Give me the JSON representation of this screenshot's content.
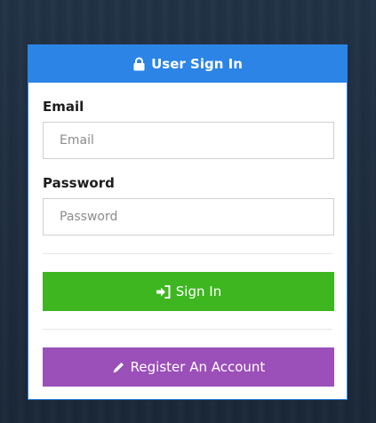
{
  "header": {
    "title": "User Sign In",
    "icon": "lock-icon",
    "color": "#2b84e6"
  },
  "form": {
    "email_label": "Email",
    "email_placeholder": "Email",
    "password_label": "Password",
    "password_placeholder": "Password"
  },
  "buttons": {
    "signin_label": "Sign In",
    "signin_icon": "sign-in-icon",
    "signin_color": "#3db620",
    "register_label": "Register An Account",
    "register_icon": "pencil-icon",
    "register_color": "#9b4fb8"
  }
}
